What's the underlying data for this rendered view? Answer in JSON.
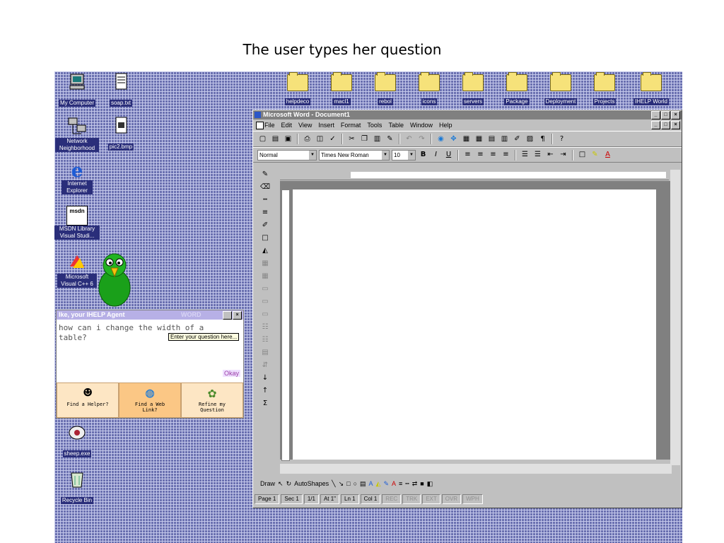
{
  "caption": "The user types her question",
  "desktop_icons_left": [
    {
      "label": "My Computer"
    },
    {
      "label": "soap.txt"
    },
    {
      "label": "Network Neighborhood"
    },
    {
      "label": "pic2.bmp"
    },
    {
      "label": "Internet Explorer"
    },
    {
      "label": "MSDN Library Visual Studi..."
    },
    {
      "label": "Microsoft Visual C++ 6"
    },
    {
      "label": "sheep.exe"
    },
    {
      "label": "Recycle Bin"
    }
  ],
  "desktop_icons_top": [
    "helpdeco",
    "macl1",
    "rebol",
    "icons",
    "servers",
    "Package",
    "Deployment",
    "Projects",
    "IHELP World"
  ],
  "word": {
    "title": "Microsoft Word - Document1",
    "menu": [
      "File",
      "Edit",
      "View",
      "Insert",
      "Format",
      "Tools",
      "Table",
      "Window",
      "Help"
    ],
    "style": "Normal",
    "font": "Times New Roman",
    "size": "10",
    "draw_label": "Draw",
    "autoshapes_label": "AutoShapes",
    "status": {
      "page": "Page 1",
      "sec": "Sec 1",
      "pages": "1/1",
      "at": "At 1\"",
      "ln": "Ln 1",
      "col": "Col 1",
      "rec": "REC",
      "trk": "TRK",
      "ext": "EXT",
      "ovr": "OVR",
      "wph": "WPH"
    }
  },
  "agent": {
    "title": "Ike, your IHELP Agent",
    "watermark": "WORD",
    "question": "how can i change the width of a\ntable?",
    "tooltip": "Enter your question here...",
    "okay": "Okay",
    "buttons": [
      "Find a Helper?",
      "Find a Web Link?",
      "Refine my Question"
    ]
  }
}
